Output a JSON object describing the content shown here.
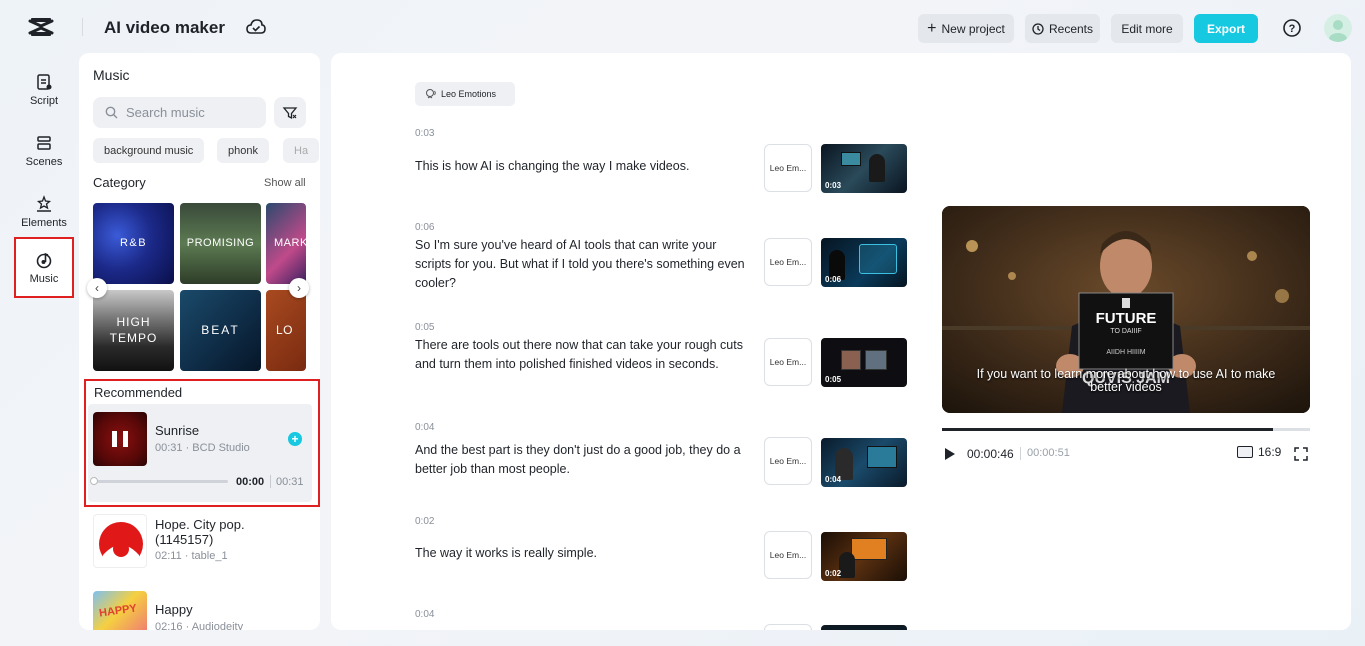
{
  "header": {
    "title": "AI video maker",
    "new_project": "New project",
    "recents": "Recents",
    "edit_more": "Edit more",
    "export": "Export"
  },
  "rail": {
    "items": [
      {
        "label": "Script",
        "icon": "script-icon"
      },
      {
        "label": "Scenes",
        "icon": "scenes-icon"
      },
      {
        "label": "Elements",
        "icon": "elements-icon"
      },
      {
        "label": "Music",
        "icon": "music-icon",
        "active": true
      }
    ]
  },
  "music_panel": {
    "title": "Music",
    "search_placeholder": "Search music",
    "chips": [
      "background music",
      "phonk",
      "Ha"
    ],
    "category_title": "Category",
    "show_all": "Show all",
    "categories": [
      "R&B",
      "PROMISING",
      "MARK",
      "HIGH TEMPO",
      "BEAT",
      "LO"
    ],
    "recommended_title": "Recommended",
    "tracks": [
      {
        "name": "Sunrise",
        "meta": "00:31 · BCD Studio",
        "position": "00:00",
        "duration": "00:31",
        "playing": true,
        "progress": 0
      },
      {
        "name": "Hope. City pop. (1145157)",
        "meta": "02:11 · table_1"
      },
      {
        "name": "Happy",
        "meta": "02:16 · Audiodeity",
        "thumb_text": "HAPPY"
      }
    ]
  },
  "script": {
    "voice": "Leo Emotions",
    "voice_short": "Leo Em...",
    "scenes": [
      {
        "time": "0:03",
        "text": "This is how AI is changing the way I make videos.",
        "clip_duration": "0:03"
      },
      {
        "time": "0:06",
        "text": "So I'm sure you've heard of AI tools that can write your scripts for you. But what if I told you there's something even cooler?",
        "clip_duration": "0:06"
      },
      {
        "time": "0:05",
        "text": "There are tools out there now that can take your rough cuts and turn them into polished finished videos in seconds.",
        "clip_duration": "0:05"
      },
      {
        "time": "0:04",
        "text": "And the best part is they don't just do a good job, they do a better job than most people.",
        "clip_duration": "0:04"
      },
      {
        "time": "0:02",
        "text": "The way it works is really simple.",
        "clip_duration": "0:02"
      },
      {
        "time": "0:04",
        "text": ""
      }
    ]
  },
  "player": {
    "sign_title": "FUTURE",
    "sign_sub": "TO DAIIIF",
    "sign_line": "AIIDH HIIIIM",
    "sign_caption": "QUVIS JAM",
    "caption": "If you want to learn more about how to use AI to make better videos",
    "current_time": "00:00:46",
    "total_time": "00:00:51",
    "progress": 0.9,
    "aspect": "16:9"
  }
}
